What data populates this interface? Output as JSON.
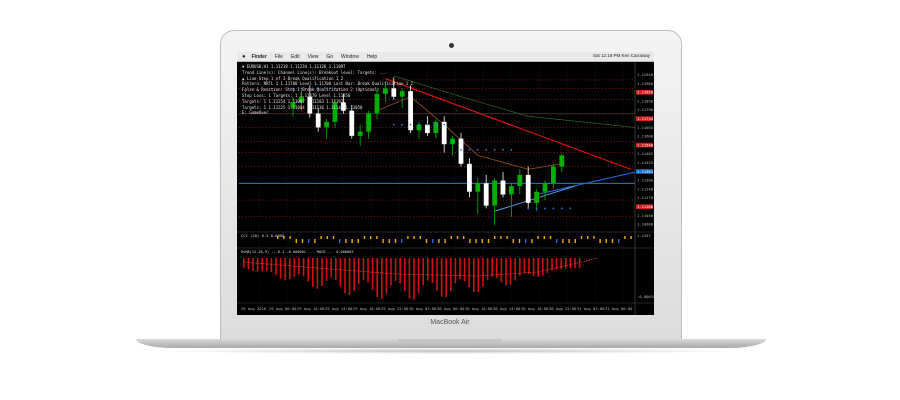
{
  "device": {
    "brand_label": "MacBook Air"
  },
  "menubar": {
    "app": "Finder",
    "items": [
      "File",
      "Edit",
      "View",
      "Go",
      "Window",
      "Help"
    ],
    "status": "Sat 12:18 PM   Ken Carraway"
  },
  "chart": {
    "info_lines": [
      "▼ EURUSD,H1  1.11218 1.11234 1.11126 1.11097",
      "Trend Line(s): Channel Line(s): Breakout level: Targets: ...",
      "▲ Line Step 1 of 3 Break Qualification 1 2",
      "Pattern: NRTL 1 1.11700 Level 1.11700 Last Bar: Break Qualification 1 2",
      "False & Reaction: Step 1 Break Qualification 2 (Optional)",
      "Stop Loss: 1 Targets: 1 1.11470 Level 1.11350",
      "Targets: 1 1.11254 1.11087 1.11183 1.11197",
      "Targets: 1 1.11225 1.11064 1.11136 1.11149 1.11050",
      "E: GameOver"
    ],
    "price_labels": [
      "1.12040",
      "1.11980",
      "1.11920",
      "1.11850",
      "1.11790",
      "1.11734",
      "1.11665",
      "1.11600",
      "1.11540",
      "1.11482",
      "1.11425",
      "1.11361",
      "1.11300",
      "1.11240",
      "1.11170",
      "1.11100",
      "1.11040",
      "1.10980"
    ],
    "highlighted_prices": [
      {
        "value": "1.11920",
        "color": "#d11e1e"
      },
      {
        "value": "1.11734",
        "color": "#d11e1e"
      },
      {
        "value": "1.11540",
        "color": "#d11e1e"
      },
      {
        "value": "1.11361",
        "color": "#0a78c8"
      },
      {
        "value": "1.11100",
        "color": "#d11e1e"
      }
    ],
    "cci_label": "CCI (20) 0.5 0.0000",
    "cci_scale": "1.1257",
    "osma_label": "OsMA(12,26,9) ...0.1 -0.000001 ... MACD ... 0.000003",
    "osma_scale": "-0.000153",
    "time_labels": [
      "29 Aug 2016",
      "29 Aug 06:00",
      "29 Aug 10:00",
      "29 Aug 14:00",
      "29 Aug 18:00",
      "29 Aug 22:00",
      "30 Aug 02:00",
      "30 Aug 06:00",
      "30 Aug 10:00",
      "30 Aug 14:00",
      "30 Aug 18:00",
      "30 Aug 22:00",
      "31 Aug 02:00",
      "31 Aug 06:00"
    ],
    "candles": [
      {
        "o": 1.1182,
        "h": 1.119,
        "l": 1.1176,
        "c": 1.1186
      },
      {
        "o": 1.1186,
        "h": 1.1195,
        "l": 1.118,
        "c": 1.119
      },
      {
        "o": 1.119,
        "h": 1.1198,
        "l": 1.1175,
        "c": 1.1178
      },
      {
        "o": 1.1178,
        "h": 1.1182,
        "l": 1.1165,
        "c": 1.1168
      },
      {
        "o": 1.1168,
        "h": 1.1174,
        "l": 1.116,
        "c": 1.1172
      },
      {
        "o": 1.1172,
        "h": 1.1188,
        "l": 1.1168,
        "c": 1.1186
      },
      {
        "o": 1.1186,
        "h": 1.1192,
        "l": 1.1178,
        "c": 1.118
      },
      {
        "o": 1.118,
        "h": 1.1184,
        "l": 1.116,
        "c": 1.1162
      },
      {
        "o": 1.1162,
        "h": 1.117,
        "l": 1.1155,
        "c": 1.1165
      },
      {
        "o": 1.1165,
        "h": 1.118,
        "l": 1.116,
        "c": 1.1178
      },
      {
        "o": 1.1178,
        "h": 1.1196,
        "l": 1.1174,
        "c": 1.1192
      },
      {
        "o": 1.1192,
        "h": 1.12,
        "l": 1.1186,
        "c": 1.1196
      },
      {
        "o": 1.1196,
        "h": 1.1204,
        "l": 1.1188,
        "c": 1.119
      },
      {
        "o": 1.119,
        "h": 1.1196,
        "l": 1.1182,
        "c": 1.1194
      },
      {
        "o": 1.1194,
        "h": 1.1198,
        "l": 1.1164,
        "c": 1.1166
      },
      {
        "o": 1.1166,
        "h": 1.1172,
        "l": 1.116,
        "c": 1.117
      },
      {
        "o": 1.117,
        "h": 1.1176,
        "l": 1.1162,
        "c": 1.1164
      },
      {
        "o": 1.1164,
        "h": 1.1174,
        "l": 1.116,
        "c": 1.1172
      },
      {
        "o": 1.1172,
        "h": 1.1176,
        "l": 1.115,
        "c": 1.1156
      },
      {
        "o": 1.1156,
        "h": 1.1162,
        "l": 1.1148,
        "c": 1.116
      },
      {
        "o": 1.116,
        "h": 1.1164,
        "l": 1.114,
        "c": 1.1142
      },
      {
        "o": 1.1142,
        "h": 1.1146,
        "l": 1.1118,
        "c": 1.1122
      },
      {
        "o": 1.1122,
        "h": 1.1132,
        "l": 1.1106,
        "c": 1.1128
      },
      {
        "o": 1.1128,
        "h": 1.1134,
        "l": 1.111,
        "c": 1.1112
      },
      {
        "o": 1.1112,
        "h": 1.1132,
        "l": 1.1098,
        "c": 1.113
      },
      {
        "o": 1.113,
        "h": 1.1136,
        "l": 1.1118,
        "c": 1.112
      },
      {
        "o": 1.112,
        "h": 1.1128,
        "l": 1.1104,
        "c": 1.1126
      },
      {
        "o": 1.1126,
        "h": 1.1138,
        "l": 1.112,
        "c": 1.1134
      },
      {
        "o": 1.1134,
        "h": 1.114,
        "l": 1.111,
        "c": 1.1114
      },
      {
        "o": 1.1114,
        "h": 1.1124,
        "l": 1.1108,
        "c": 1.1122
      },
      {
        "o": 1.1122,
        "h": 1.113,
        "l": 1.1116,
        "c": 1.1128
      },
      {
        "o": 1.1128,
        "h": 1.1142,
        "l": 1.1124,
        "c": 1.114
      },
      {
        "o": 1.114,
        "h": 1.115,
        "l": 1.1136,
        "c": 1.1148
      }
    ],
    "colors": {
      "bull": "#00b000",
      "bear": "#ffffff",
      "trend": "#e01414",
      "support": "#1e6fe0",
      "channel": "#2a7fd0",
      "osma_bar": "#d21010",
      "dots": "#3a6ee8"
    }
  }
}
